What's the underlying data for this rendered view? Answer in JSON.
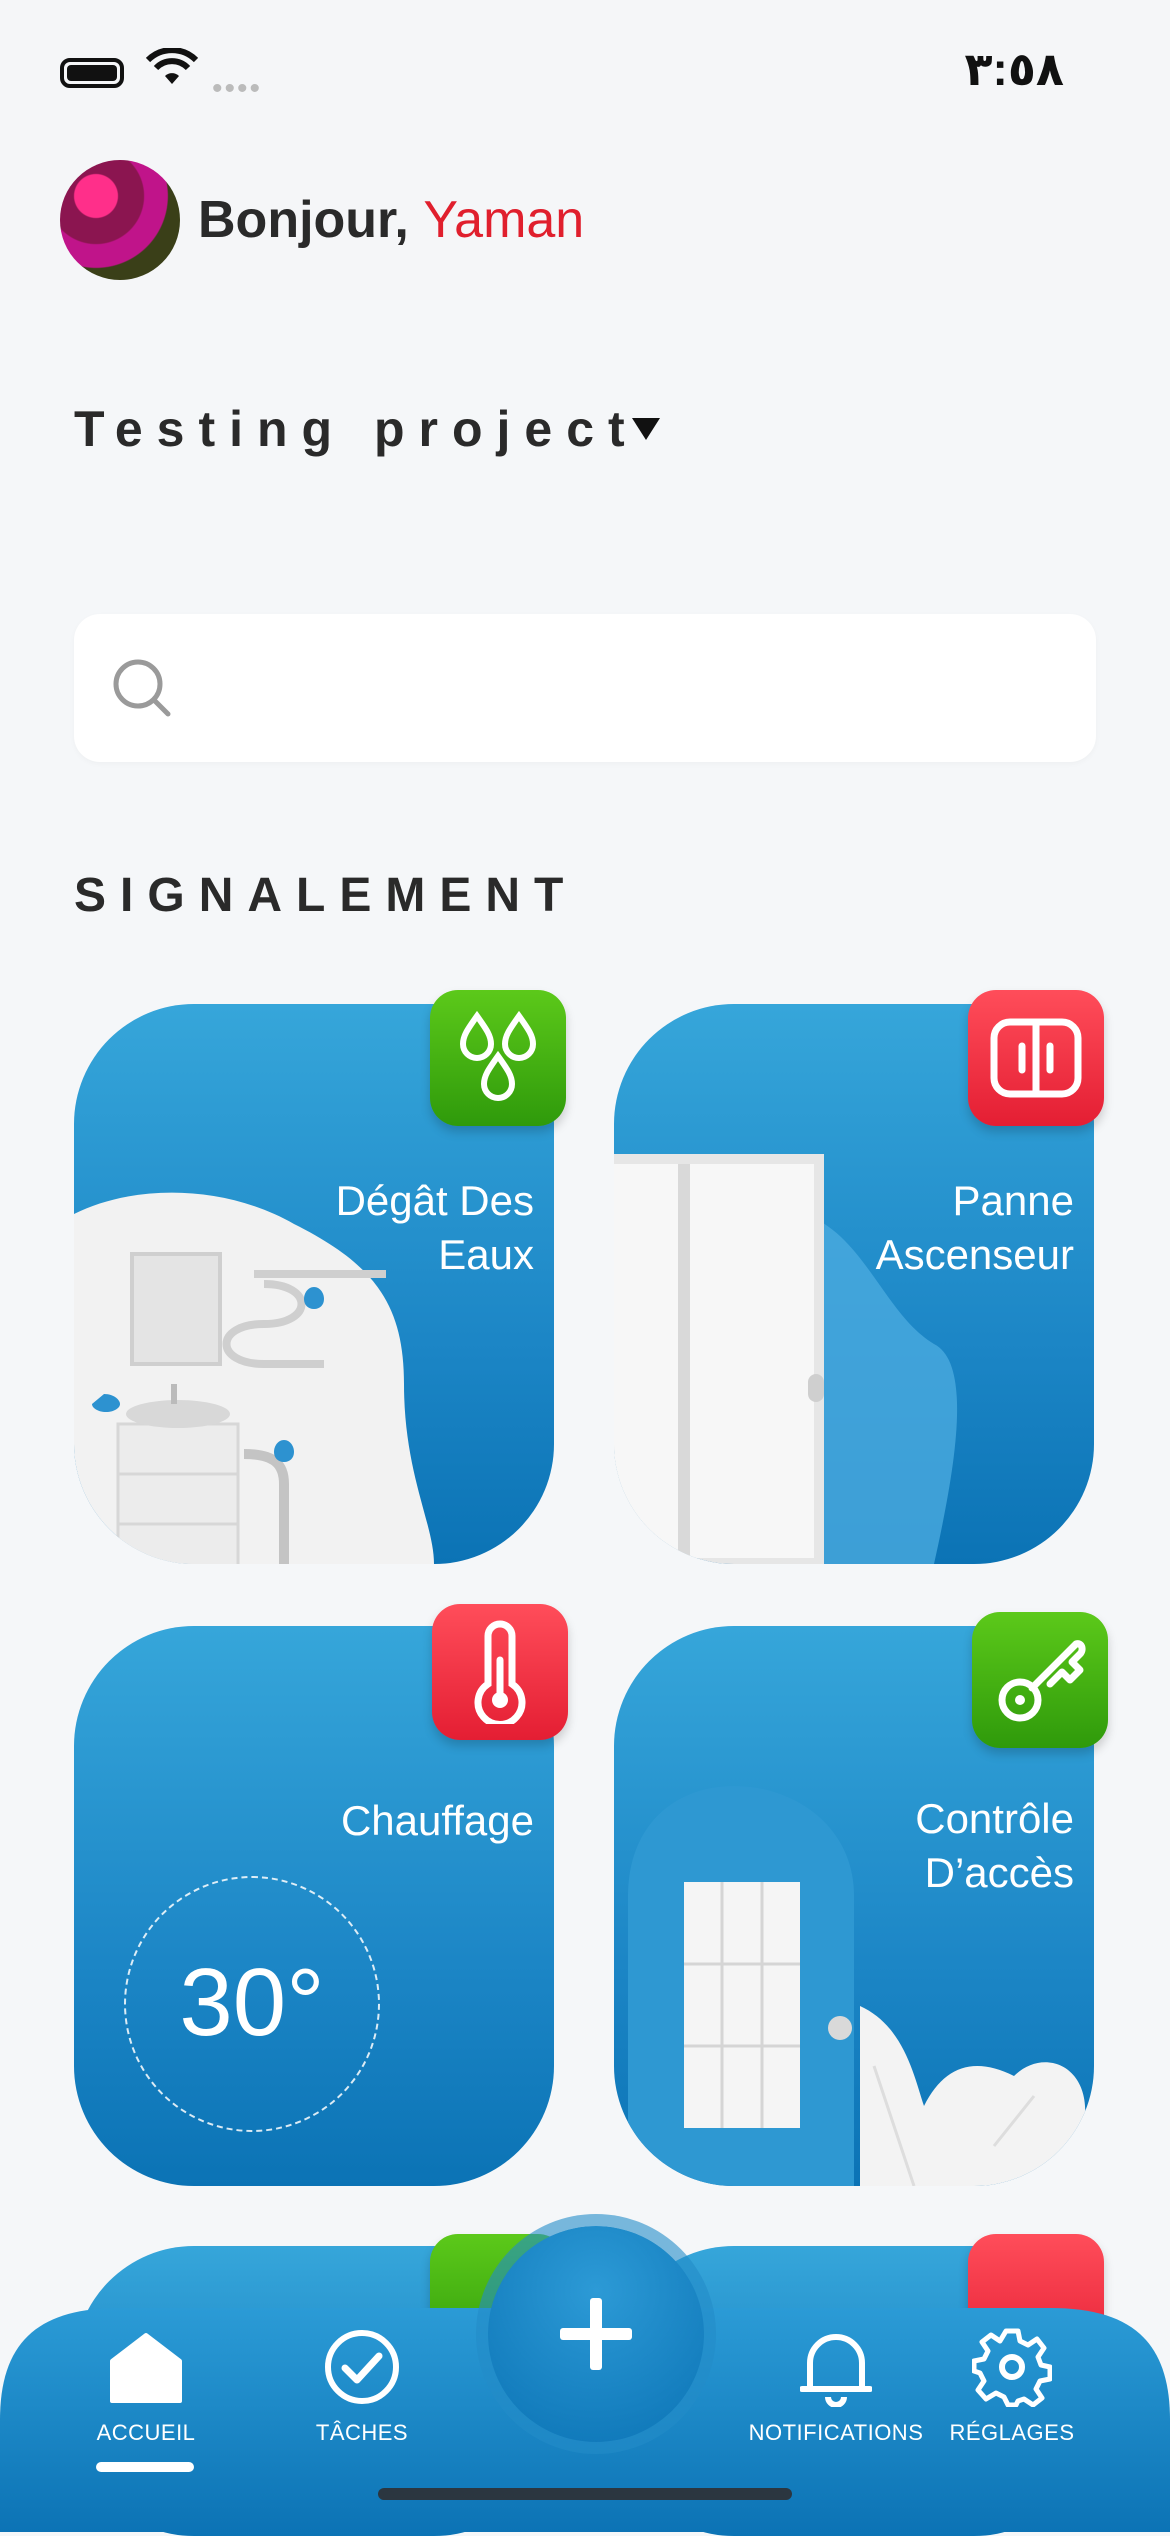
{
  "status_bar": {
    "time": "٣:٥٨"
  },
  "header": {
    "greeting": "Bonjour,",
    "user_name": "Yaman"
  },
  "project": {
    "name": "Testing project"
  },
  "search": {
    "placeholder": ""
  },
  "section": {
    "title": "SIGNALEMENT"
  },
  "cards": [
    {
      "label_line1": "Dégât Des",
      "label_line2": "Eaux",
      "icon": "water-drops-icon",
      "badge_color": "#3fb012"
    },
    {
      "label_line1": "Panne",
      "label_line2": "Ascenseur",
      "icon": "elevator-icon",
      "badge_color": "#f02c40"
    },
    {
      "label_line1": "Chauffage",
      "label_line2": "",
      "icon": "thermometer-icon",
      "badge_color": "#f02c40",
      "temperature": "30°"
    },
    {
      "label_line1": "Contrôle",
      "label_line2": "D’accès",
      "icon": "key-icon",
      "badge_color": "#3fb012"
    }
  ],
  "bottom_nav": {
    "items": [
      {
        "label": "ACCUEIL",
        "icon": "home-icon"
      },
      {
        "label": "TÂCHES",
        "icon": "check-circle-icon"
      },
      {
        "label": "NOTIFICATIONS",
        "icon": "bell-icon"
      },
      {
        "label": "RÉGLAGES",
        "icon": "gear-icon"
      }
    ],
    "fab_icon": "plus-icon"
  }
}
